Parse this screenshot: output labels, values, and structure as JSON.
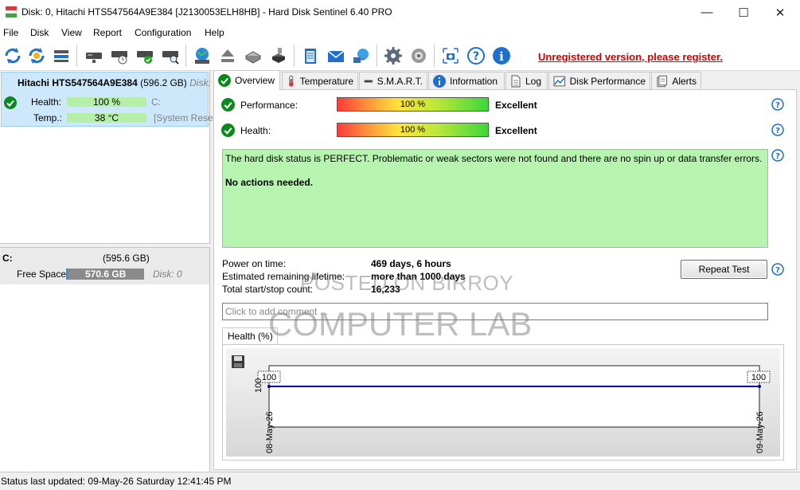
{
  "window": {
    "title": "Disk: 0, Hitachi HTS547564A9E384 [J2130053ELH8HB]  -  Hard Disk Sentinel 6.40 PRO",
    "minimize": "—",
    "maximize": "☐",
    "close": "✕"
  },
  "menu": [
    "File",
    "Disk",
    "View",
    "Report",
    "Configuration",
    "Help"
  ],
  "toolbar": {
    "icons": [
      "refresh-icon",
      "refresh-all-icon",
      "disk-list-icon",
      "disk-info-icon",
      "disk-schedule-icon",
      "disk-ok-icon",
      "disk-search-icon",
      "globe-disk-icon",
      "eject-icon",
      "drive-tools-icon",
      "drive-export-icon",
      "notepad-icon",
      "mail-icon",
      "network-icon",
      "settings-icon",
      "sound-icon",
      "screenshot-icon",
      "help-icon",
      "info-icon"
    ],
    "register_link": "Unregistered version, please register.",
    "register_color": "#d40000"
  },
  "disk": {
    "name": "Hitachi HTS547564A9E384",
    "size": "(596.2 GB)",
    "disk_suffix": "Disk:",
    "health_label": "Health:",
    "health_value": "100 %",
    "health_partition": "C:",
    "temp_label": "Temp.:",
    "temp_value": "38 °C",
    "temp_partition": "[System Rese"
  },
  "volume": {
    "letter": "C:",
    "size": "(595.6 GB)",
    "free_label": "Free Space",
    "free_value": "570.6 GB",
    "disk_ref": "Disk: 0"
  },
  "tabs": [
    {
      "label": "Overview",
      "icon": "check-icon"
    },
    {
      "label": "Temperature",
      "icon": "thermometer-icon"
    },
    {
      "label": "S.M.A.R.T.",
      "icon": "smart-icon"
    },
    {
      "label": "Information",
      "icon": "info-icon"
    },
    {
      "label": "Log",
      "icon": "log-icon"
    },
    {
      "label": "Disk Performance",
      "icon": "chart-icon"
    },
    {
      "label": "Alerts",
      "icon": "alerts-icon"
    }
  ],
  "overview": {
    "performance_label": "Performance:",
    "performance_value": "100 %",
    "performance_rating": "Excellent",
    "health_label": "Health:",
    "health_value": "100 %",
    "health_rating": "Excellent",
    "status_line1": "The hard disk status is PERFECT. Problematic or weak sectors were not found and there are no spin up or data transfer errors.",
    "status_line2": "No actions needed.",
    "power_on_label": "Power on time:",
    "power_on_value": "469 days, 6 hours",
    "lifetime_label": "Estimated remaining lifetime:",
    "lifetime_value": "more than 1000 days",
    "startstop_label": "Total start/stop count:",
    "startstop_value": "16,233",
    "repeat_button": "Repeat Test",
    "comment_placeholder": "Click to add comment ..."
  },
  "chart_data": {
    "type": "line",
    "title": "Health (%)",
    "x": [
      "08-May-26",
      "09-May-26"
    ],
    "series": [
      {
        "values": [
          100,
          100
        ]
      }
    ],
    "ytick": "100",
    "ylim": [
      0,
      100
    ],
    "line_color": "#0000a0"
  },
  "watermark": {
    "line1": "POSTED ON BIRROY",
    "line2": "COMPUTER LAB"
  },
  "status": "Status last updated: 09-May-26 Saturday 12:41:45 PM"
}
